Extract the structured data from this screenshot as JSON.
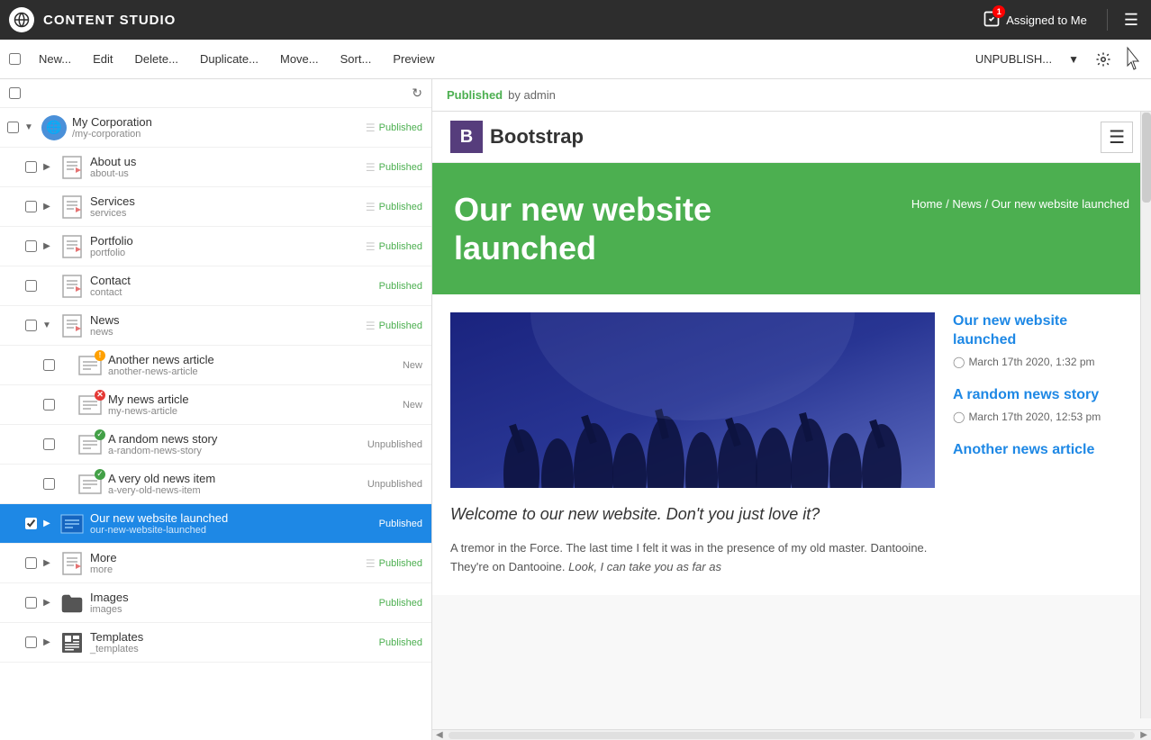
{
  "app": {
    "title": "CONTENT STUDIO",
    "assigned_label": "Assigned to Me",
    "assigned_count": "1"
  },
  "toolbar": {
    "new_label": "New...",
    "edit_label": "Edit",
    "delete_label": "Delete...",
    "duplicate_label": "Duplicate...",
    "move_label": "Move...",
    "sort_label": "Sort...",
    "preview_label": "Preview",
    "unpublish_label": "UNPUBLISH...",
    "gear_label": "⚙"
  },
  "tree": {
    "items": [
      {
        "id": "my-corporation",
        "name": "My Corporation",
        "path": "/my-corporation",
        "status": "Published",
        "level": 0,
        "expanded": true,
        "has_expand": true,
        "icon": "globe"
      },
      {
        "id": "about-us",
        "name": "About us",
        "path": "about-us",
        "status": "Published",
        "level": 1,
        "has_expand": true,
        "icon": "page"
      },
      {
        "id": "services",
        "name": "Services",
        "path": "services",
        "status": "Published",
        "level": 1,
        "has_expand": true,
        "icon": "page"
      },
      {
        "id": "portfolio",
        "name": "Portfolio",
        "path": "portfolio",
        "status": "Published",
        "level": 1,
        "has_expand": true,
        "icon": "page"
      },
      {
        "id": "contact",
        "name": "Contact",
        "path": "contact",
        "status": "Published",
        "level": 1,
        "has_expand": false,
        "icon": "page"
      },
      {
        "id": "news",
        "name": "News",
        "path": "news",
        "status": "Published",
        "level": 1,
        "expanded": true,
        "has_expand": true,
        "icon": "page"
      },
      {
        "id": "another-news",
        "name": "Another news article",
        "path": "another-news-article",
        "status": "New",
        "level": 2,
        "has_expand": false,
        "icon": "news-warn"
      },
      {
        "id": "my-news",
        "name": "My news article",
        "path": "my-news-article",
        "status": "New",
        "level": 2,
        "has_expand": false,
        "icon": "news-error"
      },
      {
        "id": "random-news",
        "name": "A random news story",
        "path": "a-random-news-story",
        "status": "Unpublished",
        "level": 2,
        "has_expand": false,
        "icon": "news-ok"
      },
      {
        "id": "old-news",
        "name": "A very old news item",
        "path": "a-very-old-news-item",
        "status": "Unpublished",
        "level": 2,
        "has_expand": false,
        "icon": "news-ok"
      },
      {
        "id": "our-new-website",
        "name": "Our new website launched",
        "path": "our-new-website-launched",
        "status": "Published",
        "level": 2,
        "has_expand": true,
        "icon": "news-sel",
        "selected": true
      },
      {
        "id": "more",
        "name": "More",
        "path": "more",
        "status": "Published",
        "level": 1,
        "has_expand": true,
        "icon": "page"
      },
      {
        "id": "images",
        "name": "Images",
        "path": "images",
        "status": "Published",
        "level": 1,
        "has_expand": true,
        "icon": "folder"
      },
      {
        "id": "templates",
        "name": "Templates",
        "path": "_templates",
        "status": "Published",
        "level": 1,
        "has_expand": true,
        "icon": "templates"
      }
    ]
  },
  "preview": {
    "status": "Published",
    "by": "by admin",
    "nav_brand": "Bootstrap",
    "hero_title": "Our new website launched",
    "breadcrumb_home": "Home",
    "breadcrumb_sep": "/",
    "breadcrumb_news": "News",
    "breadcrumb_page": "Our new website launched",
    "quote": "Welcome to our new website. Don't you just love it?",
    "body_text": "A tremor in the Force. The last time I felt it was in the presence of my old master. Dantooine. They're on Dantooine.",
    "body_text_italic": "Look, I can take you as far as",
    "sidebar": {
      "articles": [
        {
          "title": "Our new website launched",
          "date": "March 17th 2020, 1:32 pm"
        },
        {
          "title": "A random news story",
          "date": "March 17th 2020, 12:53 pm"
        },
        {
          "title": "Another news article",
          "date": ""
        }
      ]
    }
  }
}
